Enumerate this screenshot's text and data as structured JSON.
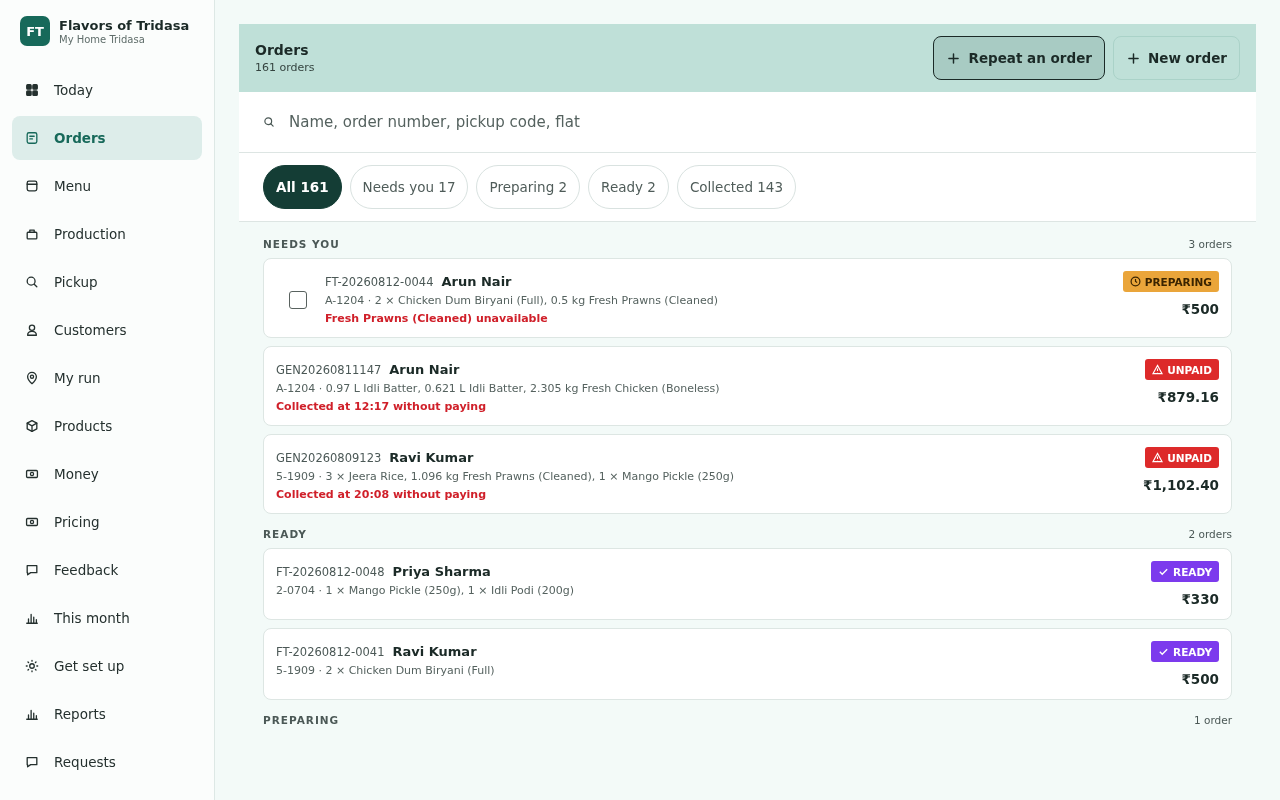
{
  "brand": {
    "logo": "FT",
    "name": "Flavors of Tridasa",
    "subtitle": "My Home Tridasa"
  },
  "nav": [
    {
      "label": "Today",
      "selected": false
    },
    {
      "label": "Orders",
      "selected": true
    },
    {
      "label": "Menu",
      "selected": false
    },
    {
      "label": "Production",
      "selected": false
    },
    {
      "label": "Pickup",
      "selected": false
    },
    {
      "label": "Customers",
      "selected": false
    },
    {
      "label": "My run",
      "selected": false
    },
    {
      "label": "Products",
      "selected": false
    },
    {
      "label": "Money",
      "selected": false
    },
    {
      "label": "Pricing",
      "selected": false
    },
    {
      "label": "Feedback",
      "selected": false
    },
    {
      "label": "This month",
      "selected": false
    },
    {
      "label": "Get set up",
      "selected": false
    },
    {
      "label": "Reports",
      "selected": false
    },
    {
      "label": "Requests",
      "selected": false
    }
  ],
  "header": {
    "title": "Orders",
    "subtitle": "161 orders",
    "buttons": [
      {
        "label": "Repeat an order",
        "kind": "primary"
      },
      {
        "label": "New order",
        "kind": "secondary"
      }
    ]
  },
  "search": {
    "placeholder": "Name, order number, pickup code, flat"
  },
  "filters": [
    {
      "label": "All 161",
      "selected": true
    },
    {
      "label": "Needs you 17",
      "selected": false
    },
    {
      "label": "Preparing 2",
      "selected": false
    },
    {
      "label": "Ready 2",
      "selected": false
    },
    {
      "label": "Collected 143",
      "selected": false
    }
  ],
  "sections": [
    {
      "title": "NEEDS YOU",
      "count": "3 orders",
      "orders": [
        {
          "number": "FT-20260812-0044",
          "name": "Arun Nair",
          "details": "A-1204 · 2 × Chicken Dum Biryani (Full), 0.5 kg Fresh Prawns (Cleaned)",
          "alert": "Fresh Prawns (Cleaned) unavailable",
          "checked": false,
          "status": {
            "label": "PREPARING",
            "kind": "preparing"
          },
          "total": "₹500"
        },
        {
          "number": "GEN20260811147",
          "name": "Arun Nair",
          "details": "A-1204 · 0.97 L Idli Batter, 0.621 L Idli Batter, 2.305 kg Fresh Chicken (Boneless)",
          "alert": "Collected at 12:17 without paying",
          "status": {
            "label": "UNPAID",
            "kind": "unpaid"
          },
          "total": "₹879.16"
        },
        {
          "number": "GEN20260809123",
          "name": "Ravi Kumar",
          "details": "5-1909 · 3 × Jeera Rice, 1.096 kg Fresh Prawns (Cleaned), 1 × Mango Pickle (250g)",
          "alert": "Collected at 20:08 without paying",
          "status": {
            "label": "UNPAID",
            "kind": "unpaid"
          },
          "total": "₹1,102.40"
        }
      ]
    },
    {
      "title": "READY",
      "count": "2 orders",
      "orders": [
        {
          "number": "FT-20260812-0048",
          "name": "Priya Sharma",
          "details": "2-0704 · 1 × Mango Pickle (250g), 1 × Idli Podi (200g)",
          "status": {
            "label": "READY",
            "kind": "ready"
          },
          "total": "₹330"
        },
        {
          "number": "FT-20260812-0041",
          "name": "Ravi Kumar",
          "details": "5-1909 · 2 × Chicken Dum Biryani (Full)",
          "status": {
            "label": "READY",
            "kind": "ready"
          },
          "total": "₹500"
        }
      ]
    },
    {
      "title": "PREPARING",
      "count": "1 order"
    }
  ]
}
